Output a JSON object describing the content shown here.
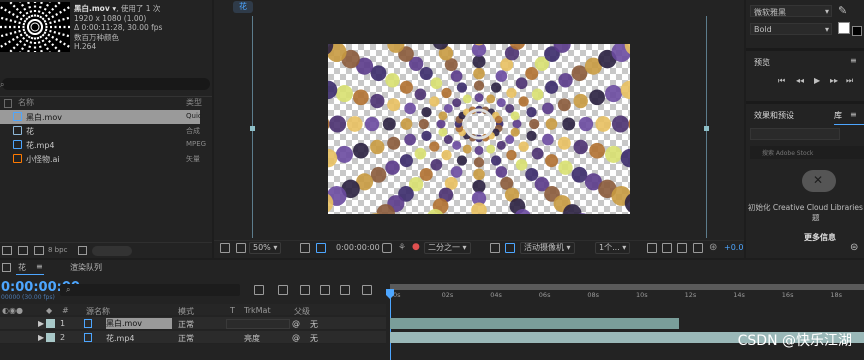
{
  "project": {
    "item_name": "黑白.mov ▾",
    "used_text": ", 使用了 1 次",
    "resolution": "1920 x 1080 (1.00)",
    "duration": "Δ 0:00:11:28, 30.00 fps",
    "colors": "数百万种颜色",
    "codec": "H.264",
    "col_name": "名称",
    "col_type": "类型",
    "items": [
      {
        "name": "黑白.mov",
        "type": "Quic",
        "selected": true,
        "icon_color": "#4da6ff"
      },
      {
        "name": "花",
        "type": "合成",
        "selected": false,
        "icon_color": "#8fb8d8"
      },
      {
        "name": "花.mp4",
        "type": "MPEG",
        "selected": false,
        "icon_color": "#4da6ff"
      },
      {
        "name": "小怪物.ai",
        "type": "矢量",
        "selected": false,
        "icon_color": "#ff7a00"
      }
    ],
    "bpc": "8 bpc"
  },
  "viewer": {
    "tab": "花",
    "zoom": "50%",
    "timecode": "0:00:00:00",
    "resolution": "二分之一",
    "camera": "活动摄像机",
    "views": "1个...",
    "exposure": "+0.0"
  },
  "right": {
    "font_name": "微软雅黑",
    "font_style": "Bold",
    "preview_title": "预览",
    "effects_title": "效果和预设",
    "library_title": "库",
    "adobe_stock": "搜索 Adobe Stock",
    "cc_line1": "初始化 Creative Cloud Libraries 时",
    "cc_line2": "题",
    "more_info": "更多信息"
  },
  "timeline": {
    "comp_tab": "花",
    "render_queue": "渲染队列",
    "timecode": "0:00:00:00",
    "fps": "00000 (30.00 fps)",
    "col_source": "源名称",
    "col_mode": "模式",
    "col_t": "T",
    "col_trkmat": "TrkMat",
    "col_parent": "父级",
    "ticks": [
      "0s",
      "02s",
      "04s",
      "06s",
      "08s",
      "10s",
      "12s",
      "14s",
      "16s",
      "18s"
    ],
    "layers": [
      {
        "num": "1",
        "name": "黑白.mov",
        "mode": "正常",
        "trkmat": "",
        "parent": "无",
        "bar_color": "#7a9e9a",
        "bar_end": 0.61,
        "selected": true
      },
      {
        "num": "2",
        "name": "花.mp4",
        "mode": "正常",
        "trkmat": "亮度",
        "parent": "无",
        "bar_color": "#9ab8b8",
        "bar_end": 1.0,
        "selected": false
      }
    ]
  },
  "watermark": "CSDN @快乐江湖",
  "colors": {
    "accent": "#4da6ff",
    "panel": "#232323",
    "bg": "#1d1d1d"
  }
}
